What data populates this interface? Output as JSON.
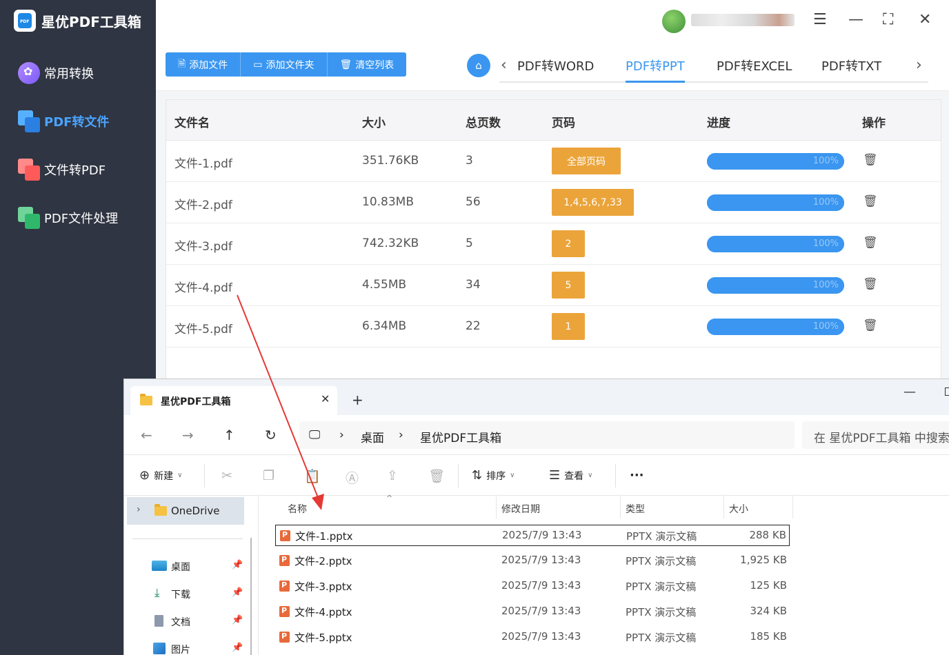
{
  "app": {
    "title": "星优PDF工具箱",
    "sidebar": [
      {
        "label": "常用转换",
        "active": false
      },
      {
        "label": "PDF转文件",
        "active": true
      },
      {
        "label": "文件转PDF",
        "active": false
      },
      {
        "label": "PDF文件处理",
        "active": false
      }
    ],
    "toolbar": {
      "add_file": "添加文件",
      "add_folder": "添加文件夹",
      "clear_list": "清空列表"
    },
    "tabs": [
      "PDF转WORD",
      "PDF转PPT",
      "PDF转EXCEL",
      "PDF转TXT"
    ],
    "active_tab": "PDF转PPT",
    "table": {
      "headers": [
        "文件名",
        "大小",
        "总页数",
        "页码",
        "进度",
        "操作"
      ],
      "rows": [
        {
          "name": "文件-1.pdf",
          "size": "351.76KB",
          "pages": "3",
          "page_range": "全部页码",
          "progress": 1.0,
          "progress_label": "100%"
        },
        {
          "name": "文件-2.pdf",
          "size": "10.83MB",
          "pages": "56",
          "page_range": "1,4,5,6,7,33",
          "progress": 1.0,
          "progress_label": "100%"
        },
        {
          "name": "文件-3.pdf",
          "size": "742.32KB",
          "pages": "5",
          "page_range": "2",
          "progress": 1.0,
          "progress_label": "100%"
        },
        {
          "name": "文件-4.pdf",
          "size": "4.55MB",
          "pages": "34",
          "page_range": "5",
          "progress": 1.0,
          "progress_label": "100%"
        },
        {
          "name": "文件-5.pdf",
          "size": "6.34MB",
          "pages": "22",
          "page_range": "1",
          "progress": 1.0,
          "progress_label": "100%"
        }
      ]
    }
  },
  "explorer": {
    "tab_title": "星优PDF工具箱",
    "path": [
      "桌面",
      "星优PDF工具箱"
    ],
    "search_placeholder": "在 星优PDF工具箱 中搜索",
    "commands": {
      "new": "新建",
      "sort": "排序",
      "view": "查看",
      "more": "···"
    },
    "sidebar": {
      "onedrive": "OneDrive",
      "items": [
        "桌面",
        "下载",
        "文档",
        "图片"
      ]
    },
    "columns": [
      "名称",
      "修改日期",
      "类型",
      "大小"
    ],
    "files": [
      {
        "name": "文件-1.pptx",
        "date": "2025/7/9 13:43",
        "type": "PPTX 演示文稿",
        "size": "288 KB"
      },
      {
        "name": "文件-2.pptx",
        "date": "2025/7/9 13:43",
        "type": "PPTX 演示文稿",
        "size": "1,925 KB"
      },
      {
        "name": "文件-3.pptx",
        "date": "2025/7/9 13:43",
        "type": "PPTX 演示文稿",
        "size": "125 KB"
      },
      {
        "name": "文件-4.pptx",
        "date": "2025/7/9 13:43",
        "type": "PPTX 演示文稿",
        "size": "324 KB"
      },
      {
        "name": "文件-5.pptx",
        "date": "2025/7/9 13:43",
        "type": "PPTX 演示文稿",
        "size": "185 KB"
      }
    ]
  },
  "colors": {
    "accent": "#3a96f0",
    "page_badge": "#eba43a",
    "sidebar_bg": "#2f3542",
    "annotation": "#e53935"
  }
}
